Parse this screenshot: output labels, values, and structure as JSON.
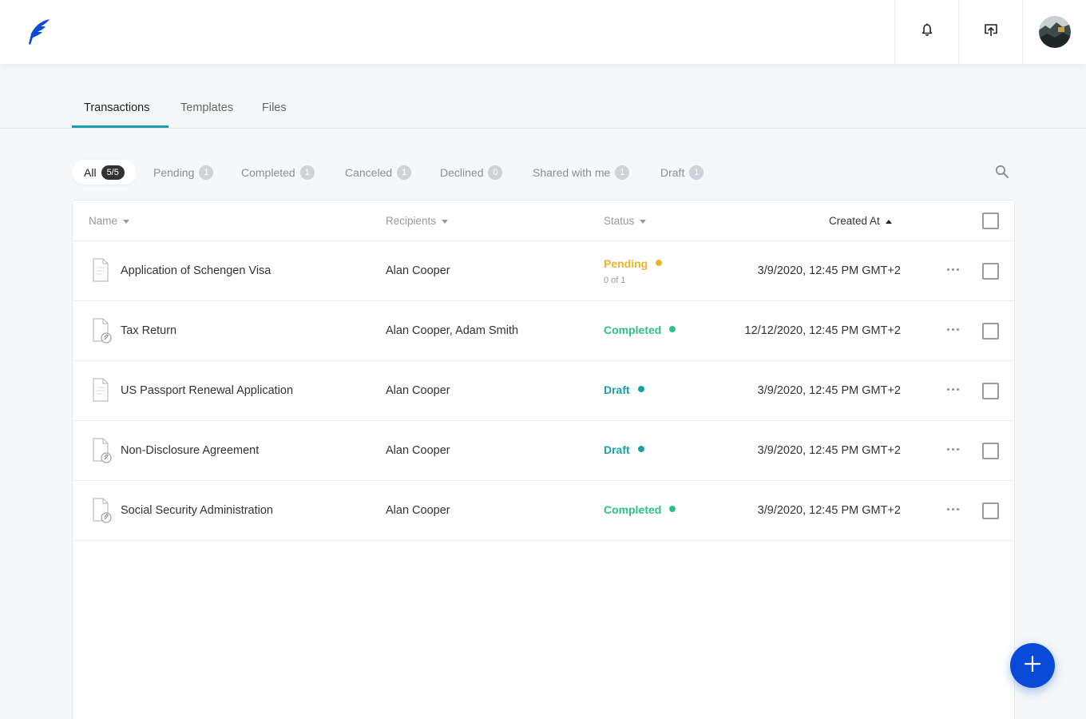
{
  "header": {
    "logo": "feather-logo",
    "icons": [
      "bell-icon",
      "upload-icon",
      "avatar"
    ]
  },
  "tabs": [
    {
      "label": "Transactions",
      "active": true
    },
    {
      "label": "Templates",
      "active": false
    },
    {
      "label": "Files",
      "active": false
    }
  ],
  "filters": [
    {
      "label": "All",
      "count": "5/5",
      "active": true
    },
    {
      "label": "Pending",
      "count": "1"
    },
    {
      "label": "Completed",
      "count": "1"
    },
    {
      "label": "Canceled",
      "count": "1"
    },
    {
      "label": "Declined",
      "count": "0"
    },
    {
      "label": "Shared with me",
      "count": "1"
    },
    {
      "label": "Draft",
      "count": "1"
    }
  ],
  "table": {
    "columns": {
      "name": "Name",
      "recipients": "Recipients",
      "status": "Status",
      "created_at": "Created At"
    },
    "rows": [
      {
        "name": "Application of Schengen Visa",
        "recipients": "Alan Cooper",
        "status": "Pending",
        "status_sub": "0 of 1",
        "created_at": "3/9/2020, 12:45 PM GMT+2",
        "icon": "document-icon"
      },
      {
        "name": "Tax Return",
        "recipients": "Alan Cooper, Adam Smith",
        "status": "Completed",
        "status_sub": "",
        "created_at": "12/12/2020, 12:45 PM GMT+2",
        "icon": "attachment-document-icon"
      },
      {
        "name": "US Passport Renewal Application",
        "recipients": "Alan Cooper",
        "status": "Draft",
        "status_sub": "",
        "created_at": "3/9/2020, 12:45 PM GMT+2",
        "icon": "document-icon"
      },
      {
        "name": "Non-Disclosure Agreement",
        "recipients": "Alan Cooper",
        "status": "Draft",
        "status_sub": "",
        "created_at": "3/9/2020, 12:45 PM GMT+2",
        "icon": "attachment-document-icon"
      },
      {
        "name": "Social Security Administration",
        "recipients": "Alan Cooper",
        "status": "Completed",
        "status_sub": "",
        "created_at": "3/9/2020, 12:45 PM GMT+2",
        "icon": "attachment-document-icon"
      }
    ]
  },
  "colors": {
    "accent": "#1ca0a8",
    "pending": "#f0b429",
    "completed": "#2fbf8f",
    "draft": "#1ca0a8",
    "fab": "#0a4ad8"
  }
}
